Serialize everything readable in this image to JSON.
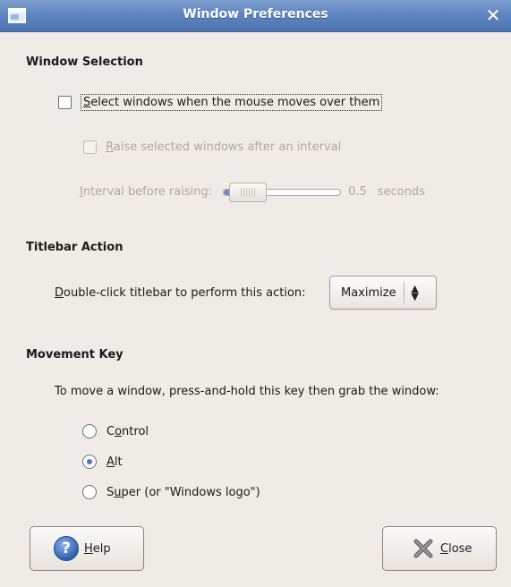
{
  "window": {
    "title": "Window Preferences",
    "close_glyph": "✕"
  },
  "window_selection": {
    "heading": "Window Selection",
    "select_windows": {
      "mnemonic": "S",
      "label_rest": "elect windows when the mouse moves over them",
      "checked": false
    },
    "raise_windows": {
      "mnemonic": "R",
      "label_rest": "aise selected windows after an interval",
      "checked": false,
      "enabled": false
    },
    "interval": {
      "mnemonic": "I",
      "label_rest": "nterval before raising:",
      "value": "0.5",
      "unit": "seconds",
      "enabled": false
    }
  },
  "titlebar_action": {
    "heading": "Titlebar Action",
    "mnemonic": "D",
    "label_rest": "ouble-click titlebar to perform this action:",
    "selected": "Maximize"
  },
  "movement_key": {
    "heading": "Movement Key",
    "instruction": "To move a window, press-and-hold this key then grab the window:",
    "options": [
      {
        "before": "C",
        "mnemonic": "o",
        "after": "ntrol",
        "checked": false
      },
      {
        "before": "",
        "mnemonic": "A",
        "after": "lt",
        "checked": true
      },
      {
        "before": "S",
        "mnemonic": "u",
        "after": "per (or \"Windows logo\")",
        "checked": false
      }
    ]
  },
  "buttons": {
    "help": {
      "mnemonic": "H",
      "label_rest": "elp",
      "icon": "help-icon"
    },
    "close": {
      "mnemonic": "C",
      "label_rest": "lose",
      "icon": "close-icon"
    }
  },
  "colors": {
    "titlebar": "#5f86c0",
    "background": "#efebe7",
    "accent": "#4f76b6"
  }
}
